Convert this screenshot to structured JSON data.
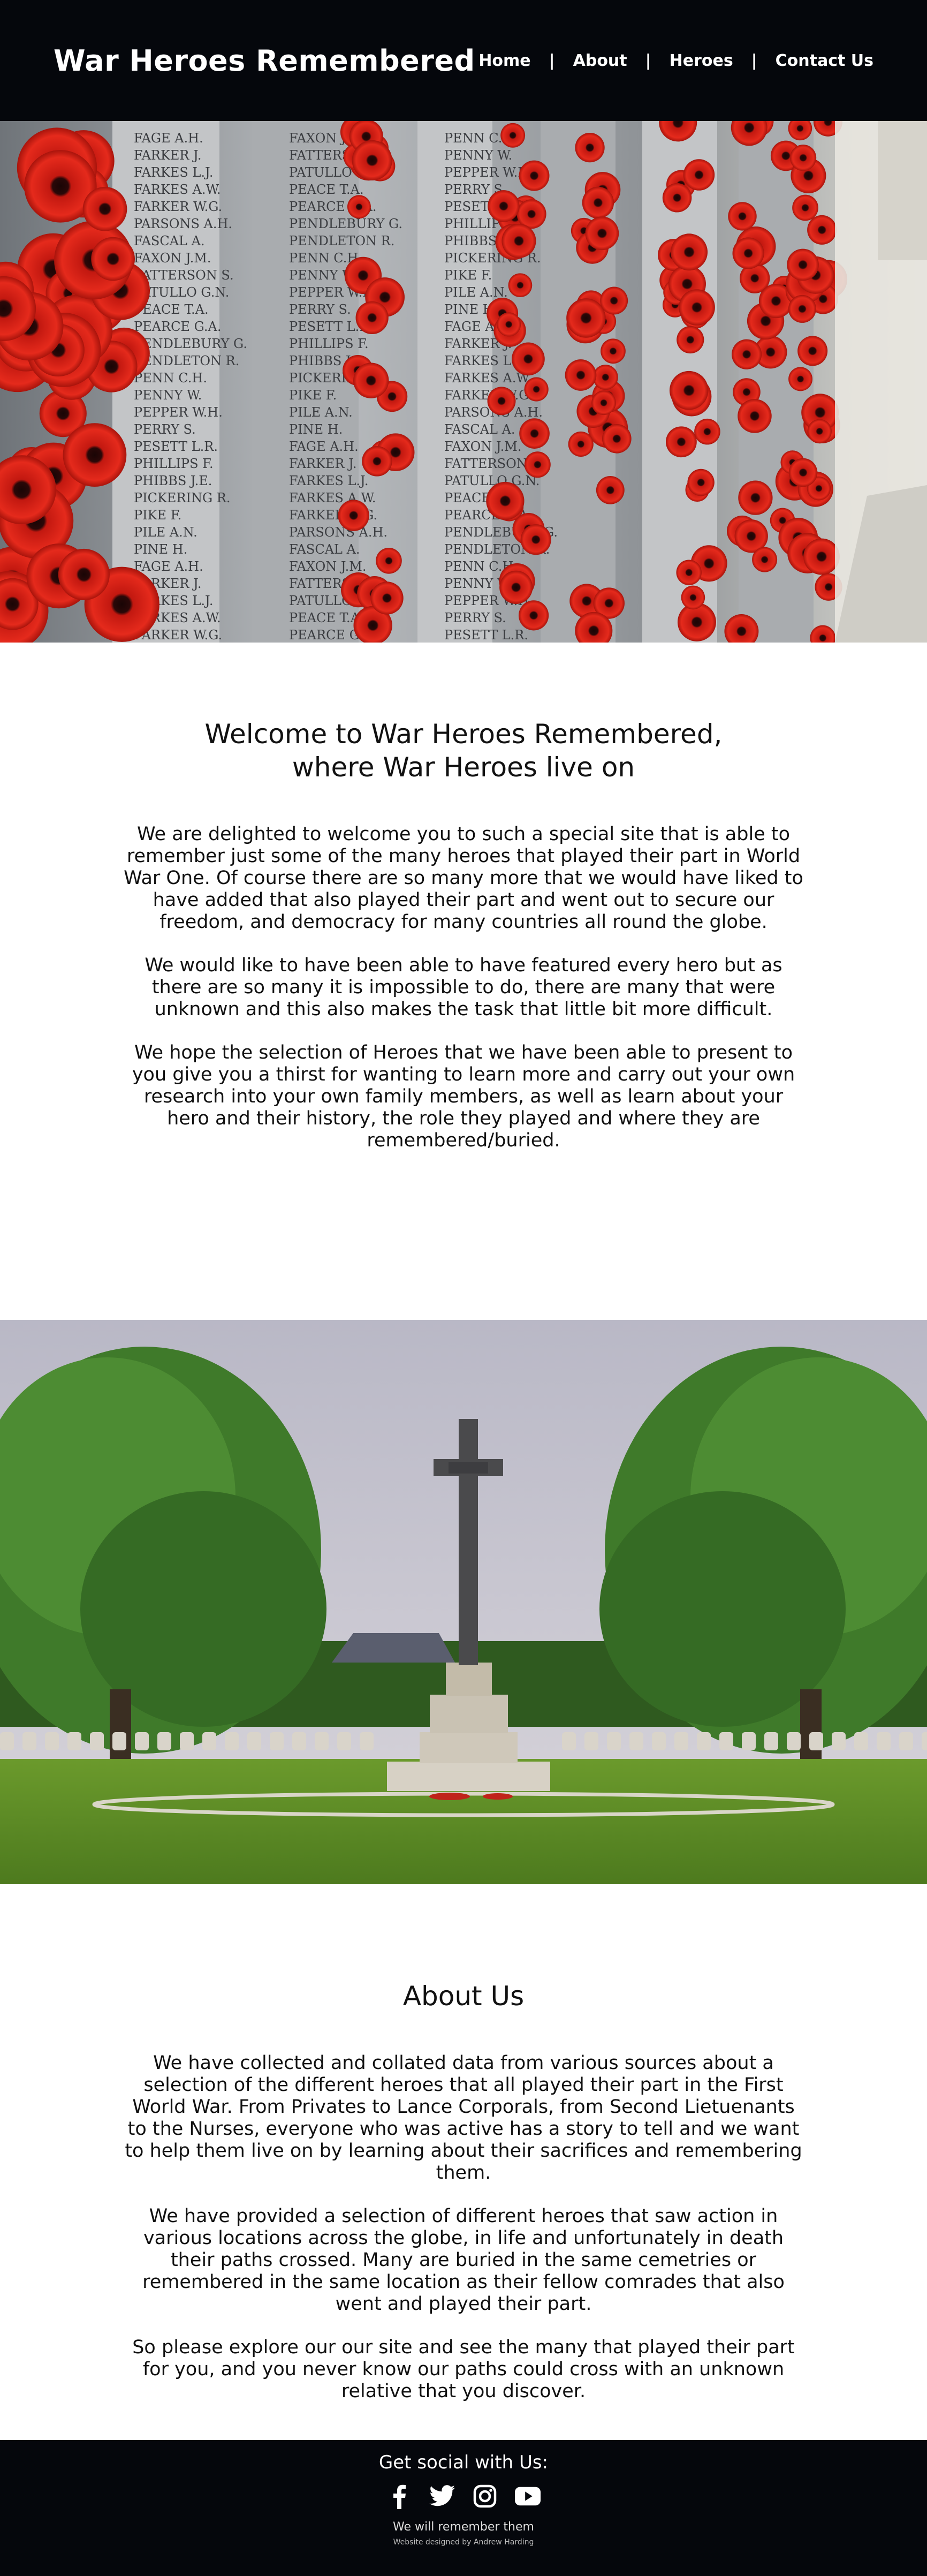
{
  "header": {
    "title": "War Heroes Remembered",
    "nav": [
      "Home",
      "About",
      "Heroes",
      "Contact Us"
    ]
  },
  "hero": {
    "image_icon": "poppy-wall-image",
    "names": [
      "FAGE A.H.",
      "FARKER J.",
      "FARKES L.J.",
      "FARKES A.W.",
      "FARKER W.G.",
      "PARSONS A.H.",
      "FASCAL A.",
      "FAXON J.M.",
      "FATTERSON S.",
      "PATULLO G.N.",
      "PEACE T.A.",
      "PEARCE G.A.",
      "PENDLEBURY G.",
      "PENDLETON R.",
      "PENN C.H.",
      "PENNY W.",
      "PEPPER W.H.",
      "PERRY S.",
      "PESETT L.R.",
      "PHILLIPS F.",
      "PHIBBS J.E.",
      "PICKERING R.",
      "PIKE F.",
      "PILE A.N.",
      "PINE H."
    ]
  },
  "welcome": {
    "heading_line1": "Welcome to War Heroes Remembered,",
    "heading_line2": "where War Heroes live on",
    "paragraphs": [
      "We are delighted to welcome you to such a special site that is able to remember just some of the many heroes that played their part in World War One. Of course there are so many more that we would have liked to have added that also played their part and went out to secure our freedom, and democracy for many countries all round the globe.",
      "We would like to have been able to have featured every hero but as there are so many it is impossible to do, there are many that were unknown and this also makes the task that little bit more difficult.",
      "We hope the selection of Heroes that we have been able to present to you give you a thirst for wanting to learn more and carry out your own research into your own family members, as well as learn about your hero and their history, the role they played and where they are remembered/buried."
    ]
  },
  "cemetery": {
    "image_icon": "war-memorial-cross-image"
  },
  "about": {
    "heading": "About Us",
    "paragraphs": [
      "We have collected and collated data from various sources about a selection of the different heroes that all played their part in the First World War. From Privates to Lance Corporals, from Second Lietuenants to the Nurses, everyone who was active has a story to tell and we want to help them live on by learning about their sacrifices and remembering them.",
      "We have provided a selection of different heroes that saw action in various locations across the globe, in life and unfortunately in death their paths crossed. Many are buried in the same cemetries or remembered in the same location as their fellow comrades that also went and played their part.",
      "So please explore our our site and see the many that played their part for you, and you never know our paths could cross with an unknown relative that you discover."
    ]
  },
  "footer": {
    "social_title": "Get social with Us:",
    "icons": [
      "facebook-icon",
      "twitter-icon",
      "instagram-icon",
      "youtube-icon"
    ],
    "tagline": "We will remember them",
    "credit": "Website designed by Andrew Harding"
  }
}
